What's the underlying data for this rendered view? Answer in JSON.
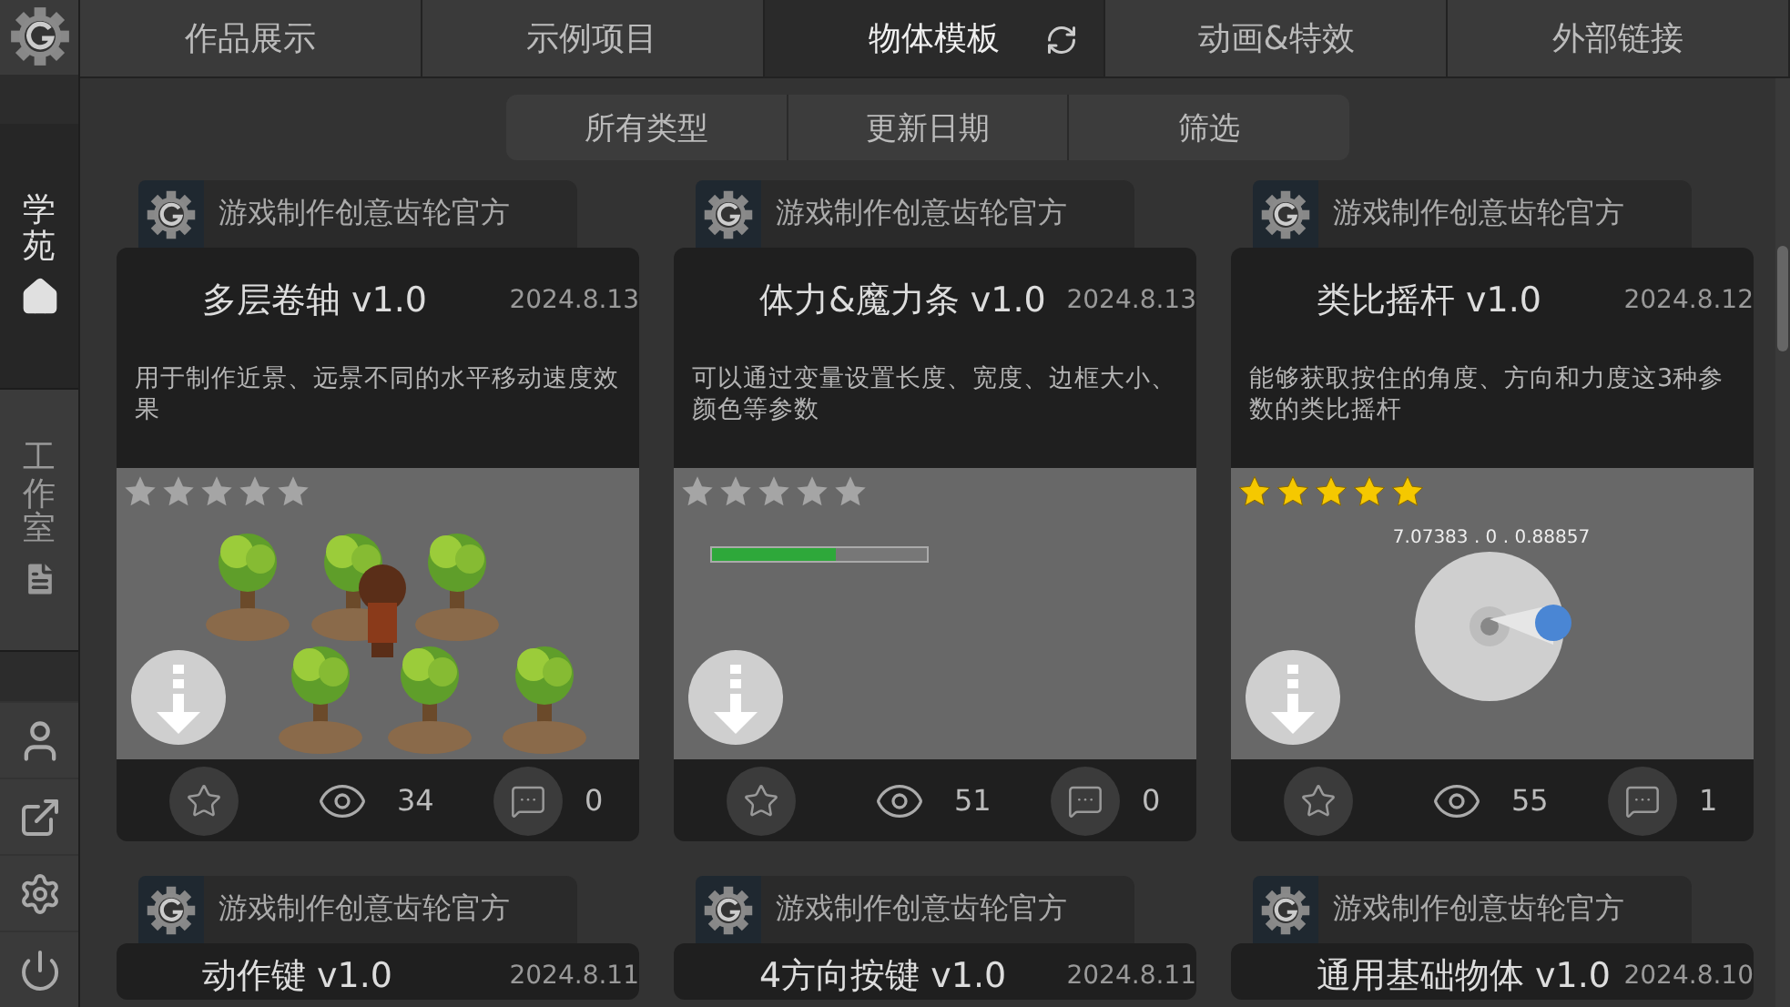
{
  "sidebar": {
    "sections": [
      {
        "label": "学苑",
        "selected": true
      },
      {
        "label": "工作室",
        "selected": false
      }
    ]
  },
  "tabs": [
    {
      "label": "作品展示",
      "selected": false
    },
    {
      "label": "示例项目",
      "selected": false
    },
    {
      "label": "物体模板",
      "selected": true
    },
    {
      "label": "动画&特效",
      "selected": false
    },
    {
      "label": "外部链接",
      "selected": false
    }
  ],
  "filters": [
    "所有类型",
    "更新日期",
    "筛选"
  ],
  "cards": [
    {
      "author": "游戏制作创意齿轮官方",
      "title": "多层卷轴 v1.0",
      "date": "2024.8.13",
      "description": "用于制作近景、远景不同的水平移动速度效果",
      "stars": 0,
      "preview": {
        "kind": "trees"
      },
      "views": "34",
      "comments": "0"
    },
    {
      "author": "游戏制作创意齿轮官方",
      "title": "体力&魔力条 v1.0",
      "date": "2024.8.13",
      "description": "可以通过变量设置长度、宽度、边框大小、颜色等参数",
      "stars": 0,
      "preview": {
        "kind": "bar",
        "level": 0.58
      },
      "views": "51",
      "comments": "0"
    },
    {
      "author": "游戏制作创意齿轮官方",
      "title": "类比摇杆 v1.0",
      "date": "2024.8.12",
      "description": "能够获取按住的角度、方向和力度这3种参数的类比摇杆",
      "stars": 5,
      "preview": {
        "kind": "joystick",
        "reading": "7.07383 . 0 . 0.88857"
      },
      "views": "55",
      "comments": "1"
    },
    {
      "author": "游戏制作创意齿轮官方",
      "title": "动作键 v1.0",
      "date": "2024.8.11"
    },
    {
      "author": "游戏制作创意齿轮官方",
      "title": "4方向按键 v1.0",
      "date": "2024.8.11"
    },
    {
      "author": "游戏制作创意齿轮官方",
      "title": "通用基础物体 v1.0",
      "date": "2024.8.10"
    }
  ]
}
